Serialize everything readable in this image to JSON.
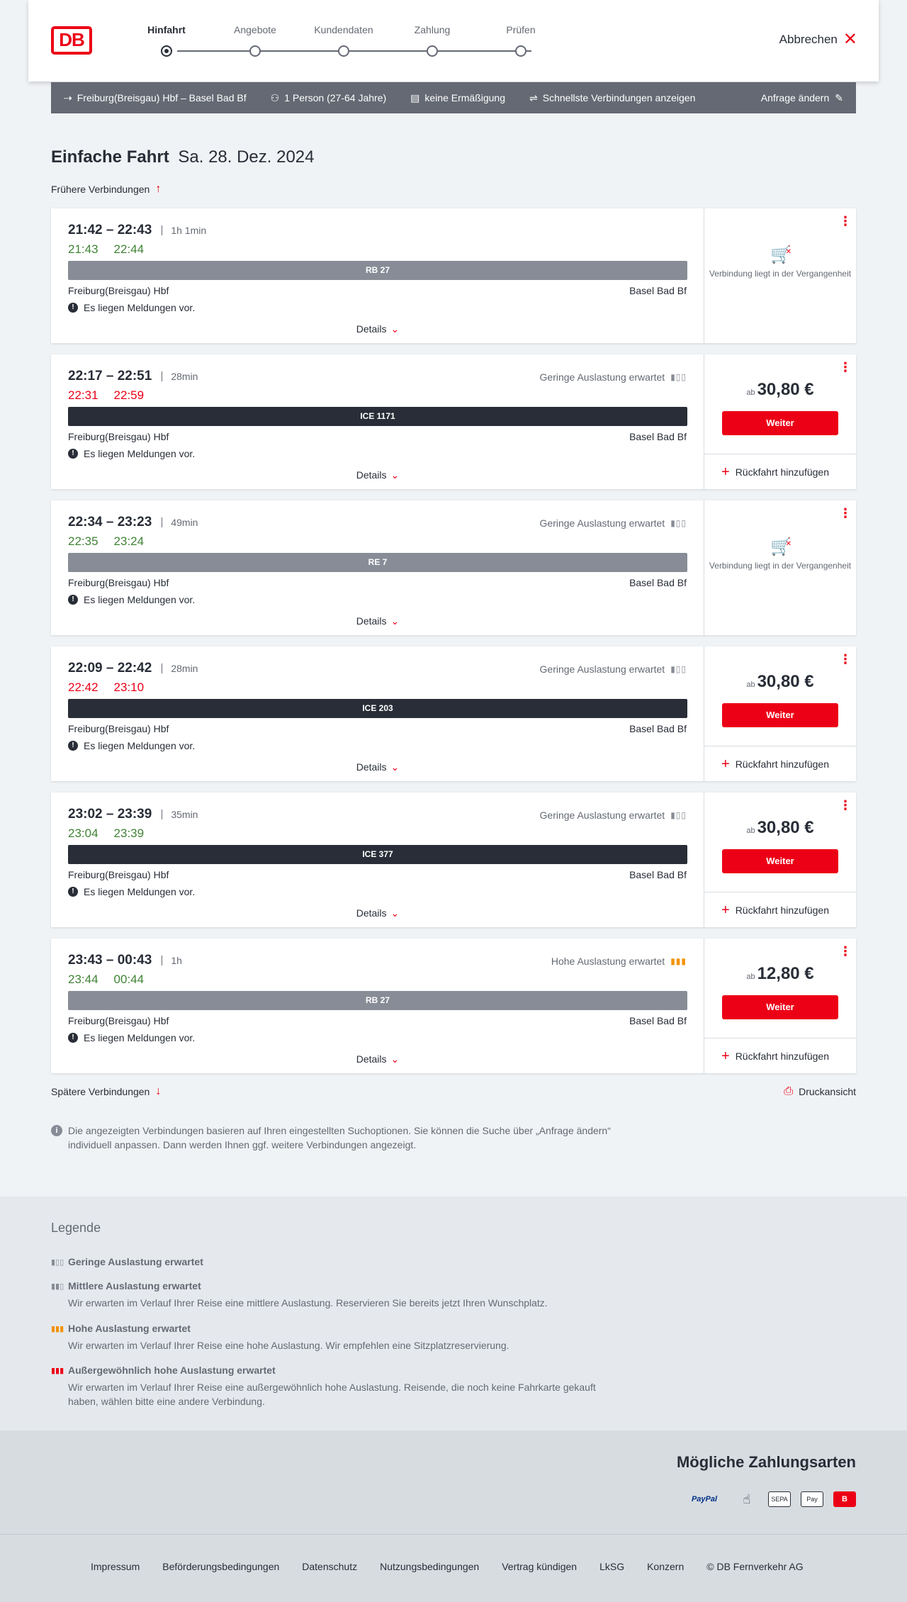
{
  "header": {
    "logo": "DB",
    "steps": [
      "Hinfahrt",
      "Angebote",
      "Kundendaten",
      "Zahlung",
      "Prüfen"
    ],
    "cancel_label": "Abbrechen"
  },
  "query": {
    "route": "Freiburg(Breisgau) Hbf – Basel Bad Bf",
    "passengers": "1 Person (27-64 Jahre)",
    "discount": "keine Ermäßigung",
    "fastest": "Schnellste Verbindungen anzeigen",
    "change": "Anfrage ändern"
  },
  "title": {
    "type": "Einfache Fahrt",
    "date": "Sa. 28. Dez. 2024"
  },
  "earlier_label": "Frühere Verbindungen",
  "later_label": "Spätere Verbindungen",
  "print_label": "Druckansicht",
  "connections": [
    {
      "times": "21:42 – 22:43",
      "duration": "1h 1min",
      "rt_dep": "21:43",
      "rt_arr": "22:44",
      "rt_color": "green",
      "load": "",
      "train": "RB 27",
      "train_style": "grey",
      "from": "Freiburg(Breisgau) Hbf",
      "to": "Basel Bad Bf",
      "message": "Es liegen Meldungen vor.",
      "details": "Details",
      "past": true,
      "past_text": "Verbindung liegt in der Vergangenheit"
    },
    {
      "times": "22:17 – 22:51",
      "duration": "28min",
      "rt_dep": "22:31",
      "rt_arr": "22:59",
      "rt_color": "red",
      "load": "Geringe Auslastung erwartet",
      "train": "ICE 1171",
      "train_style": "dark",
      "from": "Freiburg(Breisgau) Hbf",
      "to": "Basel Bad Bf",
      "message": "Es liegen Meldungen vor.",
      "details": "Details",
      "past": false,
      "price_prefix": "ab",
      "price": "30,80 €",
      "button": "Weiter",
      "return": "Rückfahrt hinzufügen"
    },
    {
      "times": "22:34 – 23:23",
      "duration": "49min",
      "rt_dep": "22:35",
      "rt_arr": "23:24",
      "rt_color": "green",
      "load": "Geringe Auslastung erwartet",
      "train": "RE 7",
      "train_style": "grey",
      "from": "Freiburg(Breisgau) Hbf",
      "to": "Basel Bad Bf",
      "message": "Es liegen Meldungen vor.",
      "details": "Details",
      "past": true,
      "past_text": "Verbindung liegt in der Vergangenheit"
    },
    {
      "times": "22:09 – 22:42",
      "duration": "28min",
      "rt_dep": "22:42",
      "rt_arr": "23:10",
      "rt_color": "red",
      "load": "Geringe Auslastung erwartet",
      "train": "ICE 203",
      "train_style": "dark",
      "from": "Freiburg(Breisgau) Hbf",
      "to": "Basel Bad Bf",
      "message": "Es liegen Meldungen vor.",
      "details": "Details",
      "past": false,
      "price_prefix": "ab",
      "price": "30,80 €",
      "button": "Weiter",
      "return": "Rückfahrt hinzufügen"
    },
    {
      "times": "23:02 – 23:39",
      "duration": "35min",
      "rt_dep": "23:04",
      "rt_arr": "23:39",
      "rt_color": "green",
      "load": "Geringe Auslastung erwartet",
      "train": "ICE 377",
      "train_style": "dark",
      "from": "Freiburg(Breisgau) Hbf",
      "to": "Basel Bad Bf",
      "message": "Es liegen Meldungen vor.",
      "details": "Details",
      "past": false,
      "price_prefix": "ab",
      "price": "30,80 €",
      "button": "Weiter",
      "return": "Rückfahrt hinzufügen"
    },
    {
      "times": "23:43 – 00:43",
      "duration": "1h",
      "rt_dep": "23:44",
      "rt_arr": "00:44",
      "rt_color": "green",
      "load": "Hohe Auslastung erwartet",
      "load_level": "high",
      "train": "RB 27",
      "train_style": "grey",
      "from": "Freiburg(Breisgau) Hbf",
      "to": "Basel Bad Bf",
      "message": "Es liegen Meldungen vor.",
      "details": "Details",
      "past": false,
      "price_prefix": "ab",
      "price": "12,80 €",
      "button": "Weiter",
      "return": "Rückfahrt hinzufügen"
    }
  ],
  "info_text": "Die angezeigten Verbindungen basieren auf Ihren eingestellten Suchoptionen. Sie können die Suche über „Anfrage ändern“ individuell anpassen. Dann werden Ihnen ggf. weitere Verbindungen angezeigt.",
  "legend": {
    "title": "Legende",
    "items": [
      {
        "title": "Geringe Auslastung erwartet",
        "desc": ""
      },
      {
        "title": "Mittlere Auslastung erwartet",
        "desc": "Wir erwarten im Verlauf Ihrer Reise eine mittlere Auslastung. Reservieren Sie bereits jetzt Ihren Wunschplatz."
      },
      {
        "title": "Hohe Auslastung erwartet",
        "desc": "Wir erwarten im Verlauf Ihrer Reise eine hohe Auslastung. Wir empfehlen eine Sitzplatzreservierung."
      },
      {
        "title": "Außergewöhnlich hohe Auslastung erwartet",
        "desc": "Wir erwarten im Verlauf Ihrer Reise eine außergewöhnlich hohe Auslastung. Reisende, die noch keine Fahrkarte gekauft haben, wählen bitte eine andere Verbindung."
      }
    ]
  },
  "payment": {
    "title": "Mögliche Zahlungsarten",
    "paypal": "PayPal",
    "sepa": "SEPA",
    "applepay": "Pay"
  },
  "footer": [
    "Impressum",
    "Beförderungsbedingungen",
    "Datenschutz",
    "Nutzungsbedingungen",
    "Vertrag kündigen",
    "LkSG",
    "Konzern",
    "© DB Fernverkehr AG"
  ]
}
